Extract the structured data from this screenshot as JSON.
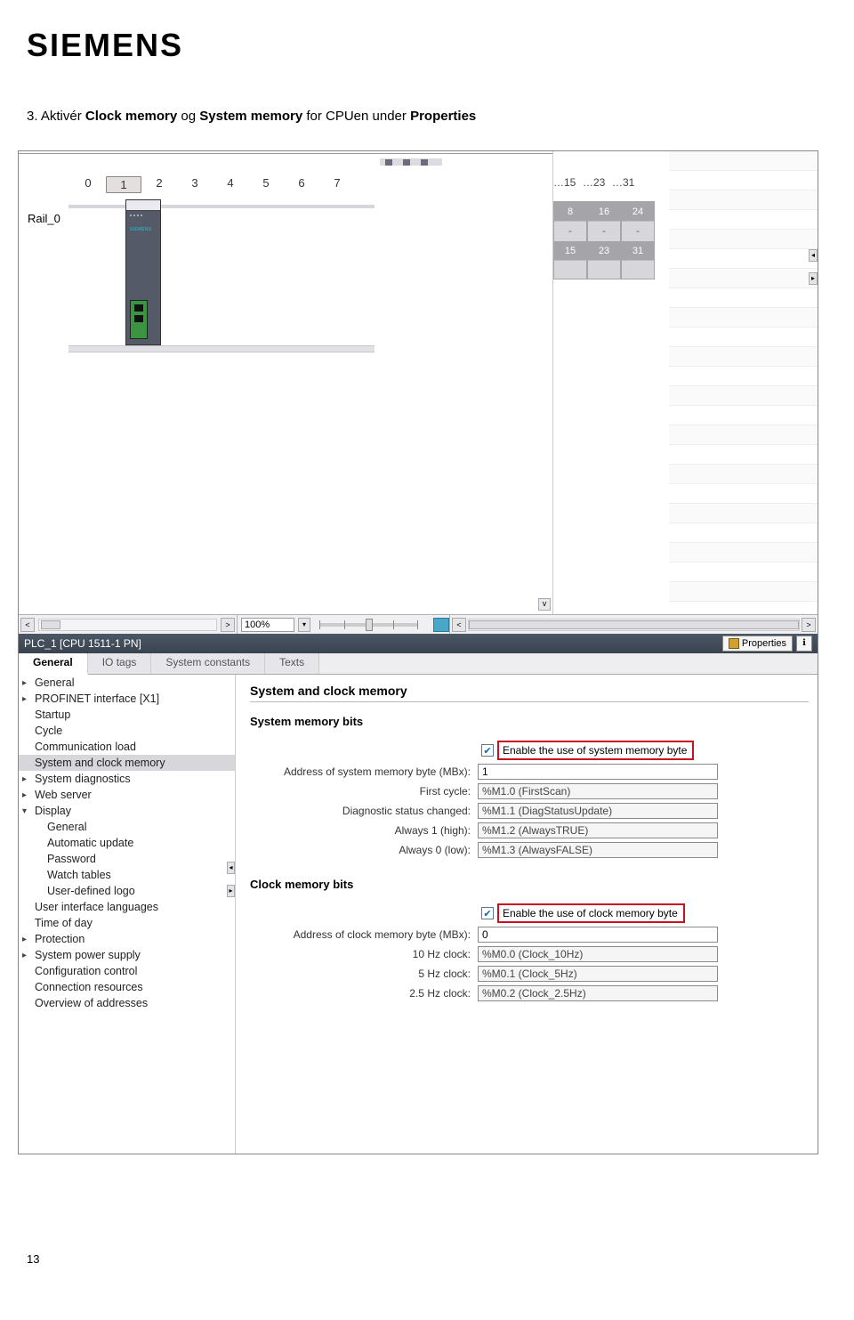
{
  "logo": "SIEMENS",
  "instruction": {
    "prefix": "3.  Aktivér ",
    "bold1": "Clock memory",
    "mid": " og ",
    "bold2": "System memory",
    "mid2": " for CPUen under ",
    "bold3": "Properties"
  },
  "rack": {
    "rail_label": "Rail_0",
    "slots": [
      "0",
      "1",
      "2",
      "3",
      "4",
      "5",
      "6",
      "7"
    ],
    "side_slots_top": [
      "…15",
      "…23",
      "…31"
    ],
    "side_slots_a": [
      "8",
      "16",
      "24"
    ],
    "side_slots_dash": [
      "-",
      "-",
      "-"
    ],
    "side_slots_b": [
      "15",
      "23",
      "31"
    ]
  },
  "zoom": {
    "value": "100%"
  },
  "inspector_title": "PLC_1 [CPU 1511-1 PN]",
  "properties_tab": "Properties",
  "tabs": [
    "General",
    "IO tags",
    "System constants",
    "Texts"
  ],
  "tree": [
    {
      "label": "General",
      "arrow": "▸",
      "lvl": 1
    },
    {
      "label": "PROFINET interface [X1]",
      "arrow": "▸",
      "lvl": 1
    },
    {
      "label": "Startup",
      "lvl": 1
    },
    {
      "label": "Cycle",
      "lvl": 1
    },
    {
      "label": "Communication load",
      "lvl": 1
    },
    {
      "label": "System and clock memory",
      "lvl": 1,
      "selected": true
    },
    {
      "label": "System diagnostics",
      "arrow": "▸",
      "lvl": 1
    },
    {
      "label": "Web server",
      "arrow": "▸",
      "lvl": 1
    },
    {
      "label": "Display",
      "arrow": "▾",
      "lvl": 1
    },
    {
      "label": "General",
      "lvl": 2
    },
    {
      "label": "Automatic update",
      "lvl": 2
    },
    {
      "label": "Password",
      "lvl": 2
    },
    {
      "label": "Watch tables",
      "lvl": 2
    },
    {
      "label": "User-defined logo",
      "lvl": 2
    },
    {
      "label": "User interface languages",
      "lvl": 1
    },
    {
      "label": "Time of day",
      "lvl": 1
    },
    {
      "label": "Protection",
      "arrow": "▸",
      "lvl": 1
    },
    {
      "label": "System power supply",
      "arrow": "▸",
      "lvl": 1
    },
    {
      "label": "Configuration control",
      "lvl": 1
    },
    {
      "label": "Connection resources",
      "lvl": 1
    },
    {
      "label": "Overview of addresses",
      "lvl": 1
    }
  ],
  "content": {
    "main_title": "System and clock memory",
    "system": {
      "heading": "System memory bits",
      "enable_label": "Enable the use of system memory byte",
      "addr_label": "Address of system memory byte (MBx):",
      "addr_value": "1",
      "rows": [
        {
          "label": "First cycle:",
          "value": "%M1.0 (FirstScan)"
        },
        {
          "label": "Diagnostic status changed:",
          "value": "%M1.1 (DiagStatusUpdate)"
        },
        {
          "label": "Always 1 (high):",
          "value": "%M1.2 (AlwaysTRUE)"
        },
        {
          "label": "Always 0 (low):",
          "value": "%M1.3 (AlwaysFALSE)"
        }
      ]
    },
    "clock": {
      "heading": "Clock memory bits",
      "enable_label": "Enable the use of clock memory byte",
      "addr_label": "Address of clock memory byte (MBx):",
      "addr_value": "0",
      "rows": [
        {
          "label": "10 Hz clock:",
          "value": "%M0.0 (Clock_10Hz)"
        },
        {
          "label": "5 Hz clock:",
          "value": "%M0.1 (Clock_5Hz)"
        },
        {
          "label": "2.5 Hz clock:",
          "value": "%M0.2 (Clock_2.5Hz)"
        }
      ]
    }
  },
  "page_number": "13"
}
